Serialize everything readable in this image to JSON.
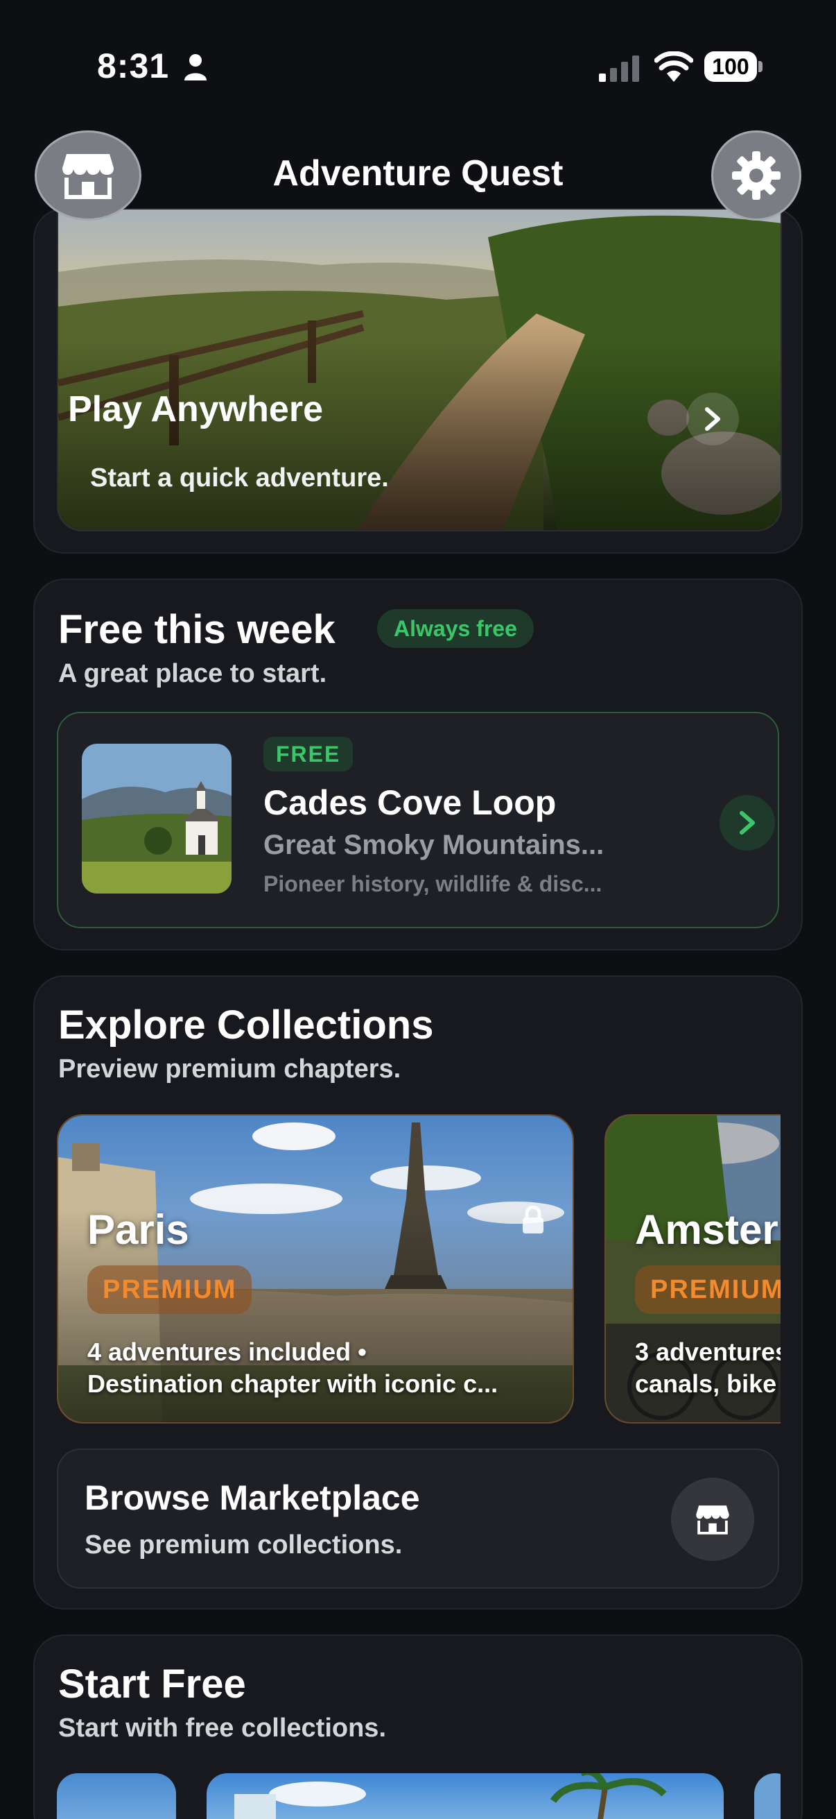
{
  "status_bar": {
    "time": "8:31",
    "battery": "100"
  },
  "header": {
    "title": "Adventure Quest"
  },
  "hero": {
    "title": "Play Anywhere",
    "subtitle": "Start a quick adventure."
  },
  "free_week": {
    "title": "Free this week",
    "badge": "Always free",
    "subtitle": "A great place to start.",
    "item": {
      "badge": "FREE",
      "name": "Cades Cove Loop",
      "location": "Great Smoky Mountains...",
      "description": "Pioneer history, wildlife & disc..."
    }
  },
  "collections": {
    "title": "Explore Collections",
    "subtitle": "Preview premium chapters.",
    "items": [
      {
        "name": "Paris",
        "badge": "PREMIUM",
        "info_line1": "4 adventures included •",
        "info_line2": "Destination chapter with iconic c..."
      },
      {
        "name": "Amster",
        "badge": "PREMIUM",
        "info_line1": "3 adventures",
        "info_line2": "canals, bike"
      }
    ],
    "browse": {
      "title": "Browse Marketplace",
      "subtitle": "See premium collections."
    }
  },
  "start_free": {
    "title": "Start Free",
    "subtitle": "Start with free collections."
  },
  "colors": {
    "background": "#0e0f13",
    "card": "#18191e",
    "accent_green": "#3cc66a",
    "accent_orange": "#f28a2e"
  },
  "icons": [
    "person-icon",
    "signal-icon",
    "wifi-icon",
    "store-icon",
    "gear-icon",
    "chevron-right-icon",
    "lock-icon"
  ]
}
